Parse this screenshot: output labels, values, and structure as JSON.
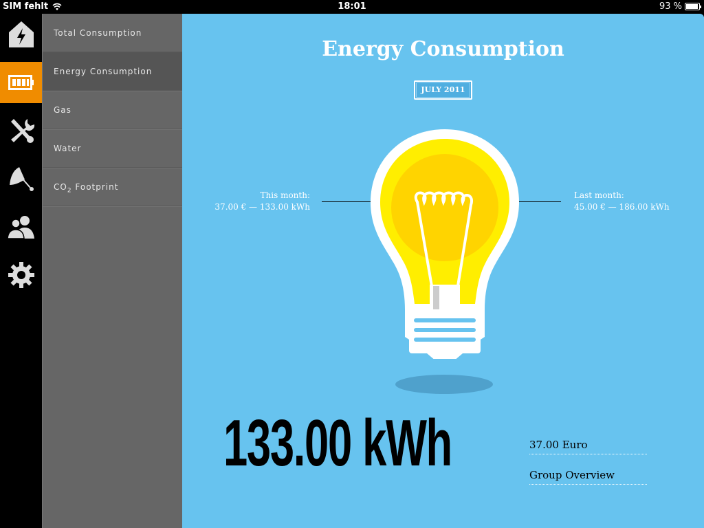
{
  "status_bar": {
    "carrier": "SIM fehlt",
    "time": "18:01",
    "battery": "93 %",
    "battery_level": 0.93
  },
  "rail": {
    "items": [
      {
        "icon": "house-lightning-icon",
        "active": false
      },
      {
        "icon": "battery-icon",
        "active": true
      },
      {
        "icon": "tools-icon",
        "active": false
      },
      {
        "icon": "satellite-dish-icon",
        "active": false
      },
      {
        "icon": "group-icon",
        "active": false
      },
      {
        "icon": "gear-icon",
        "active": false
      }
    ]
  },
  "menu": {
    "items": [
      {
        "label": "Total Consumption"
      },
      {
        "label": "Energy Consumption"
      },
      {
        "label": "Gas"
      },
      {
        "label": "Water"
      },
      {
        "label": "CO",
        "sub": "2",
        "label_after": " Footprint"
      }
    ],
    "active_index": 1
  },
  "main": {
    "title": "Energy Consumption",
    "period": "JULY 2011",
    "this_month": {
      "label": "This month:",
      "value": "37.00 € — 133.00 kWh"
    },
    "last_month": {
      "label": "Last month:",
      "value": "45.00 € — 186.00 kWh"
    },
    "big_value": "133.00 kWh",
    "euro": "37.00 Euro",
    "group_overview": "Group Overview"
  },
  "colors": {
    "accent": "#f08c00",
    "background": "#67c3ef",
    "menu": "#666666",
    "bulb_yellow": "#ffee00"
  }
}
